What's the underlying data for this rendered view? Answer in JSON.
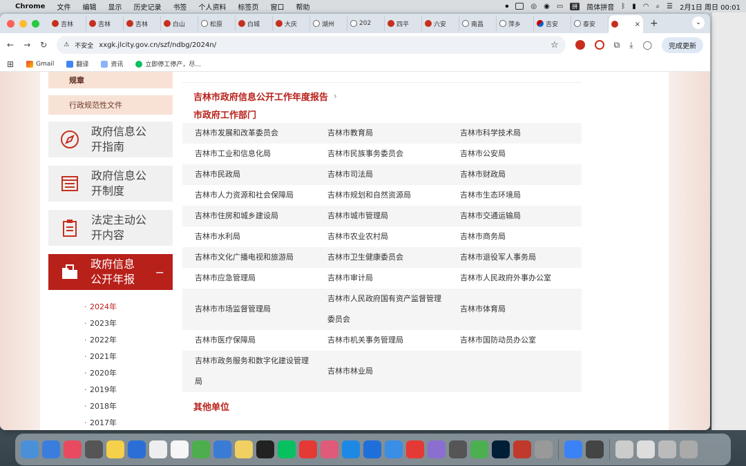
{
  "menubar": {
    "app": "Chrome",
    "items": [
      "文件",
      "编辑",
      "显示",
      "历史记录",
      "书签",
      "个人资料",
      "标签页",
      "窗口",
      "帮助"
    ],
    "input_method": "拼",
    "input_method_label": "简体拼音",
    "clock": "2月1日 周日 00:01"
  },
  "tabs": [
    {
      "label": "吉林",
      "icon": "red"
    },
    {
      "label": "吉林",
      "icon": "red"
    },
    {
      "label": "吉林",
      "icon": "red"
    },
    {
      "label": "白山",
      "icon": "red"
    },
    {
      "label": "松原",
      "icon": "globe"
    },
    {
      "label": "白城",
      "icon": "red"
    },
    {
      "label": "大庆",
      "icon": "red"
    },
    {
      "label": "湖州",
      "icon": "globe"
    },
    {
      "label": "202",
      "icon": "globe"
    },
    {
      "label": "四平",
      "icon": "red"
    },
    {
      "label": "六安",
      "icon": "red"
    },
    {
      "label": "南昌",
      "icon": "globe"
    },
    {
      "label": "萍乡",
      "icon": "globe"
    },
    {
      "label": "吉安",
      "icon": "flag"
    },
    {
      "label": "泰安",
      "icon": "globe"
    }
  ],
  "active_tab": {
    "close": "×"
  },
  "new_tab": "+",
  "toolbar": {
    "insecure_label": "不安全",
    "url": "xxgk.jlcity.gov.cn/szf/ndbg/2024n/",
    "update_label": "完成更新"
  },
  "bookmarks": [
    {
      "label": "Gmail"
    },
    {
      "label": "翻译"
    },
    {
      "label": "资讯"
    },
    {
      "label": "立即停工停产，尽..."
    }
  ],
  "sidebar": {
    "sub_items": [
      "规章",
      "行政规范性文件"
    ],
    "cards": [
      {
        "label": "政府信息公开指南",
        "icon": "compass-icon"
      },
      {
        "label": "政府信息公开制度",
        "icon": "document-list-icon"
      },
      {
        "label": "法定主动公开内容",
        "icon": "clipboard-icon"
      },
      {
        "label": "政府信息公开年报",
        "icon": "folder-icon",
        "active": true
      }
    ],
    "collapse": "−",
    "years": [
      "2024年",
      "2023年",
      "2022年",
      "2021年",
      "2020年",
      "2019年",
      "2018年",
      "2017年"
    ],
    "current_year": "2024年"
  },
  "main": {
    "report_title": "吉林市政府信息公开工作年度报告",
    "report_arrow": "›",
    "departments_title": "市政府工作部门",
    "departments": [
      [
        "吉林市发展和改革委员会",
        "吉林市教育局",
        "吉林市科学技术局"
      ],
      [
        "吉林市工业和信息化局",
        "吉林市民族事务委员会",
        "吉林市公安局"
      ],
      [
        "吉林市民政局",
        "吉林市司法局",
        "吉林市财政局"
      ],
      [
        "吉林市人力资源和社会保障局",
        "吉林市规划和自然资源局",
        "吉林市生态环境局"
      ],
      [
        "吉林市住房和城乡建设局",
        "吉林市城市管理局",
        "吉林市交通运输局"
      ],
      [
        "吉林市水利局",
        "吉林市农业农村局",
        "吉林市商务局"
      ],
      [
        "吉林市文化广播电视和旅游局",
        "吉林市卫生健康委员会",
        "吉林市退役军人事务局"
      ],
      [
        "吉林市应急管理局",
        "吉林市审计局",
        "吉林市人民政府外事办公室"
      ],
      [
        "吉林市市场监督管理局",
        "吉林市人民政府国有资产监督管理委员会",
        "吉林市体育局"
      ],
      [
        "吉林市医疗保障局",
        "吉林市机关事务管理局",
        "吉林市国防动员办公室"
      ],
      [
        "吉林市政务服务和数字化建设管理局",
        "吉林市林业局",
        ""
      ]
    ],
    "other_title": "其他单位"
  }
}
